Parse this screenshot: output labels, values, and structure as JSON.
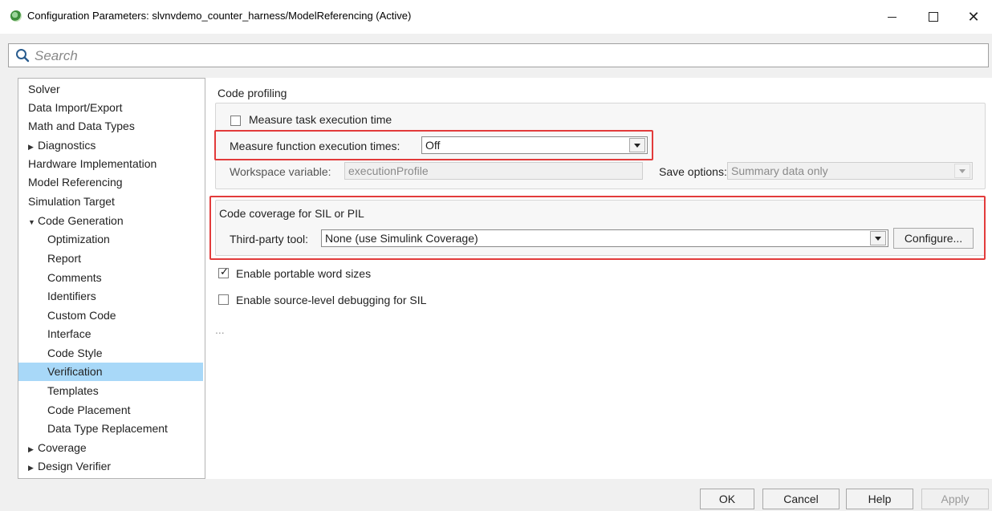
{
  "window": {
    "title": "Configuration Parameters: slvnvdemo_counter_harness/ModelReferencing (Active)",
    "minimize_glyph": "—",
    "maximize_glyph": "☐",
    "close_glyph": "✕"
  },
  "search": {
    "placeholder": "Search"
  },
  "tree": {
    "items": [
      {
        "label": "Solver"
      },
      {
        "label": "Data Import/Export"
      },
      {
        "label": "Math and Data Types"
      },
      {
        "label": "Diagnostics",
        "collapsed": true
      },
      {
        "label": "Hardware Implementation"
      },
      {
        "label": "Model Referencing"
      },
      {
        "label": "Simulation Target"
      },
      {
        "label": "Code Generation",
        "expanded": true
      },
      {
        "label": "Optimization"
      },
      {
        "label": "Report"
      },
      {
        "label": "Comments"
      },
      {
        "label": "Identifiers"
      },
      {
        "label": "Custom Code"
      },
      {
        "label": "Interface"
      },
      {
        "label": "Code Style"
      },
      {
        "label": "Verification",
        "selected": true
      },
      {
        "label": "Templates"
      },
      {
        "label": "Code Placement"
      },
      {
        "label": "Data Type Replacement"
      },
      {
        "label": "Coverage",
        "collapsed": true
      },
      {
        "label": "Design Verifier",
        "collapsed": true
      }
    ],
    "collapsed_glyph": "▶",
    "expanded_glyph": "▼"
  },
  "code_profiling": {
    "title": "Code profiling",
    "measure_task_label": "Measure task execution time",
    "measure_task_checked": false,
    "measure_function_label": "Measure function execution times:",
    "measure_function_value": "Off",
    "workspace_variable_label": "Workspace variable:",
    "workspace_variable_value": "executionProfile",
    "save_options_label": "Save options:",
    "save_options_value": "Summary data only"
  },
  "code_coverage": {
    "title": "Code coverage for SIL or PIL",
    "third_party_label": "Third-party tool:",
    "third_party_value": "None (use Simulink Coverage)",
    "configure_label": "Configure..."
  },
  "options": {
    "portable_word_label": "Enable portable word sizes",
    "portable_word_checked": true,
    "source_debug_label": "Enable source-level debugging for SIL",
    "source_debug_checked": false,
    "check_glyph": "✓",
    "more_glyph": "..."
  },
  "footer": {
    "ok_label": "OK",
    "cancel_label": "Cancel",
    "help_label": "Help",
    "apply_label": "Apply"
  },
  "colors": {
    "highlight": "#e23b3b",
    "selection": "#a8d8f8"
  }
}
